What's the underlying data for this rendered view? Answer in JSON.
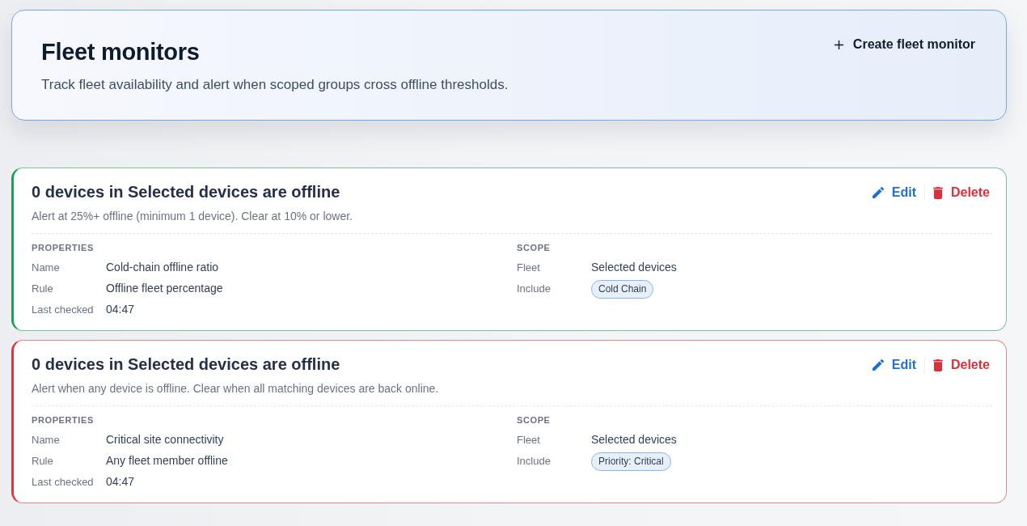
{
  "header": {
    "title": "Fleet monitors",
    "subtitle": "Track fleet availability and alert when scoped groups cross offline thresholds.",
    "create_button": {
      "label": "Create fleet monitor"
    }
  },
  "monitors": [
    {
      "color": "#1f9d55",
      "title": "0 devices in Selected devices are offline",
      "description": "Alert at 25%+ offline (minimum 1 device). Clear at 10% or lower.",
      "actions": [
        {
          "kind": "edit",
          "label": "Edit"
        },
        {
          "kind": "delete",
          "label": "Delete"
        }
      ],
      "properties": {
        "heading": "PROPERTIES",
        "rows": [
          {
            "label": "Name",
            "value": "Cold-chain offline ratio"
          },
          {
            "label": "Rule",
            "value": "Offline fleet percentage"
          },
          {
            "label": "Last checked",
            "value": "04:47"
          }
        ]
      },
      "scope": {
        "heading": "SCOPE",
        "rows": [
          {
            "kind": "text",
            "label": "Fleet",
            "value": "Selected devices"
          },
          {
            "kind": "tags",
            "label": "Include",
            "tags": [
              "Cold Chain"
            ]
          }
        ]
      }
    },
    {
      "color": "#d63a3f",
      "title": "0 devices in Selected devices are offline",
      "description": "Alert when any device is offline. Clear when all matching devices are back online.",
      "actions": [
        {
          "kind": "edit",
          "label": "Edit"
        },
        {
          "kind": "delete",
          "label": "Delete"
        }
      ],
      "properties": {
        "heading": "PROPERTIES",
        "rows": [
          {
            "label": "Name",
            "value": "Critical site connectivity"
          },
          {
            "label": "Rule",
            "value": "Any fleet member offline"
          },
          {
            "label": "Last checked",
            "value": "04:47"
          }
        ]
      },
      "scope": {
        "heading": "SCOPE",
        "rows": [
          {
            "kind": "text",
            "label": "Fleet",
            "value": "Selected devices"
          },
          {
            "kind": "tags",
            "label": "Include",
            "tags": [
              "Priority: Critical"
            ]
          }
        ]
      }
    }
  ]
}
